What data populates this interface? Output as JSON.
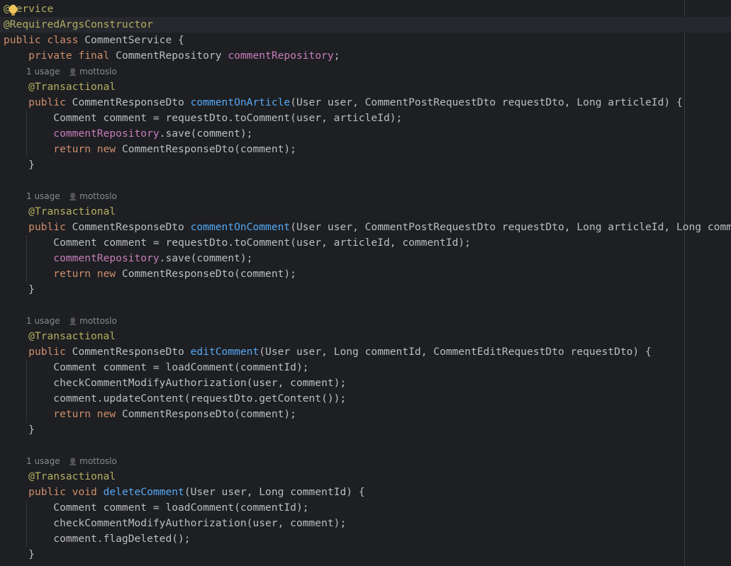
{
  "colors": {
    "background": "#1e1f22",
    "keyword": "#cf8e6d",
    "annotation": "#b3ae60",
    "field": "#c77dbb",
    "method": "#56a8f5",
    "text": "#bcbec4",
    "hint": "#868a91"
  },
  "icons": {
    "intention_bulb": "lightbulb-icon",
    "author_hint": "person-icon"
  },
  "lines": [
    {
      "type": "code",
      "tokens": [
        [
          "ann",
          "@Service"
        ]
      ]
    },
    {
      "type": "code",
      "highlight": true,
      "tokens": [
        [
          "ann",
          "@RequiredArgsConstructor"
        ]
      ]
    },
    {
      "type": "code",
      "tokens": [
        [
          "kw",
          "public class "
        ],
        [
          "plain",
          "CommentService {"
        ]
      ]
    },
    {
      "type": "code",
      "tokens": [
        [
          "plain",
          "    "
        ],
        [
          "kw",
          "private final "
        ],
        [
          "plain",
          "CommentRepository "
        ],
        [
          "fld",
          "commentRepository"
        ],
        [
          "plain",
          ";"
        ]
      ]
    },
    {
      "type": "hint",
      "usage": "1 usage",
      "author": "mottoslo"
    },
    {
      "type": "code",
      "tokens": [
        [
          "plain",
          "    "
        ],
        [
          "ann",
          "@Transactional"
        ]
      ]
    },
    {
      "type": "code",
      "tokens": [
        [
          "plain",
          "    "
        ],
        [
          "kw",
          "public "
        ],
        [
          "plain",
          "CommentResponseDto "
        ],
        [
          "fn",
          "commentOnArticle"
        ],
        [
          "plain",
          "(User user, CommentPostRequestDto requestDto, Long articleId) {"
        ]
      ]
    },
    {
      "type": "code",
      "tokens": [
        [
          "plain",
          "        Comment comment = requestDto.toComment(user, articleId);"
        ]
      ]
    },
    {
      "type": "code",
      "tokens": [
        [
          "plain",
          "        "
        ],
        [
          "fld",
          "commentRepository"
        ],
        [
          "plain",
          ".save(comment);"
        ]
      ]
    },
    {
      "type": "code",
      "tokens": [
        [
          "plain",
          "        "
        ],
        [
          "kw",
          "return new "
        ],
        [
          "plain",
          "CommentResponseDto(comment);"
        ]
      ]
    },
    {
      "type": "code",
      "tokens": [
        [
          "plain",
          "    }"
        ]
      ]
    },
    {
      "type": "blank"
    },
    {
      "type": "hint",
      "usage": "1 usage",
      "author": "mottoslo"
    },
    {
      "type": "code",
      "tokens": [
        [
          "plain",
          "    "
        ],
        [
          "ann",
          "@Transactional"
        ]
      ]
    },
    {
      "type": "code",
      "tokens": [
        [
          "plain",
          "    "
        ],
        [
          "kw",
          "public "
        ],
        [
          "plain",
          "CommentResponseDto "
        ],
        [
          "fn",
          "commentOnComment"
        ],
        [
          "plain",
          "(User user, CommentPostRequestDto requestDto, Long articleId, Long commentId) {"
        ]
      ]
    },
    {
      "type": "code",
      "tokens": [
        [
          "plain",
          "        Comment comment = requestDto.toComment(user, articleId, commentId);"
        ]
      ]
    },
    {
      "type": "code",
      "tokens": [
        [
          "plain",
          "        "
        ],
        [
          "fld",
          "commentRepository"
        ],
        [
          "plain",
          ".save(comment);"
        ]
      ]
    },
    {
      "type": "code",
      "tokens": [
        [
          "plain",
          "        "
        ],
        [
          "kw",
          "return new "
        ],
        [
          "plain",
          "CommentResponseDto(comment);"
        ]
      ]
    },
    {
      "type": "code",
      "tokens": [
        [
          "plain",
          "    }"
        ]
      ]
    },
    {
      "type": "blank"
    },
    {
      "type": "hint",
      "usage": "1 usage",
      "author": "mottoslo"
    },
    {
      "type": "code",
      "tokens": [
        [
          "plain",
          "    "
        ],
        [
          "ann",
          "@Transactional"
        ]
      ]
    },
    {
      "type": "code",
      "tokens": [
        [
          "plain",
          "    "
        ],
        [
          "kw",
          "public "
        ],
        [
          "plain",
          "CommentResponseDto "
        ],
        [
          "fn",
          "editComment"
        ],
        [
          "plain",
          "(User user, Long commentId, CommentEditRequestDto requestDto) {"
        ]
      ]
    },
    {
      "type": "code",
      "tokens": [
        [
          "plain",
          "        Comment comment = loadComment(commentId);"
        ]
      ]
    },
    {
      "type": "code",
      "tokens": [
        [
          "plain",
          "        checkCommentModifyAuthorization(user, comment);"
        ]
      ]
    },
    {
      "type": "code",
      "tokens": [
        [
          "plain",
          "        comment.updateContent(requestDto.getContent());"
        ]
      ]
    },
    {
      "type": "code",
      "tokens": [
        [
          "plain",
          "        "
        ],
        [
          "kw",
          "return new "
        ],
        [
          "plain",
          "CommentResponseDto(comment);"
        ]
      ]
    },
    {
      "type": "code",
      "tokens": [
        [
          "plain",
          "    }"
        ]
      ]
    },
    {
      "type": "blank"
    },
    {
      "type": "hint",
      "usage": "1 usage",
      "author": "mottoslo"
    },
    {
      "type": "code",
      "tokens": [
        [
          "plain",
          "    "
        ],
        [
          "ann",
          "@Transactional"
        ]
      ]
    },
    {
      "type": "code",
      "tokens": [
        [
          "plain",
          "    "
        ],
        [
          "kw",
          "public void "
        ],
        [
          "fn",
          "deleteComment"
        ],
        [
          "plain",
          "(User user, Long commentId) {"
        ]
      ]
    },
    {
      "type": "code",
      "tokens": [
        [
          "plain",
          "        Comment comment = loadComment(commentId);"
        ]
      ]
    },
    {
      "type": "code",
      "tokens": [
        [
          "plain",
          "        checkCommentModifyAuthorization(user, comment);"
        ]
      ]
    },
    {
      "type": "code",
      "tokens": [
        [
          "plain",
          "        comment.flagDeleted();"
        ]
      ]
    },
    {
      "type": "code",
      "tokens": [
        [
          "plain",
          "    }"
        ]
      ]
    }
  ]
}
